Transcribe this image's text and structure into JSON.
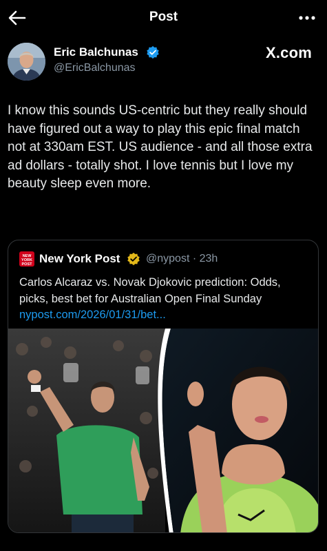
{
  "header": {
    "title": "Post",
    "back_icon": "arrow-left-icon",
    "more_icon": "ellipsis-icon"
  },
  "author": {
    "name": "Eric Balchunas",
    "handle": "@EricBalchunas",
    "verified_color": "#1d9bf0"
  },
  "source_label": "X.com",
  "tweet": {
    "text": "I know this sounds US-centric but they really should have figured out a way to play this epic final match not at 330am EST. US audience - and all those extra ad dollars - totally shot. I love tennis but I love my beauty sleep even more."
  },
  "quote": {
    "logo_text": "NEW YORK POST",
    "author_name": "New York Post",
    "handle_time": "@nypost · 23h",
    "badge_color": "#e2b719",
    "text": "Carlos Alcaraz vs. Novak Djokovic prediction: Odds, picks, best bet for Australian Open Final Sunday ",
    "link": "nypost.com/2026/01/31/bet..."
  },
  "colors": {
    "background": "#000000",
    "text": "#e7e9ea",
    "muted": "#8b98a5",
    "link": "#1d9bf0"
  }
}
